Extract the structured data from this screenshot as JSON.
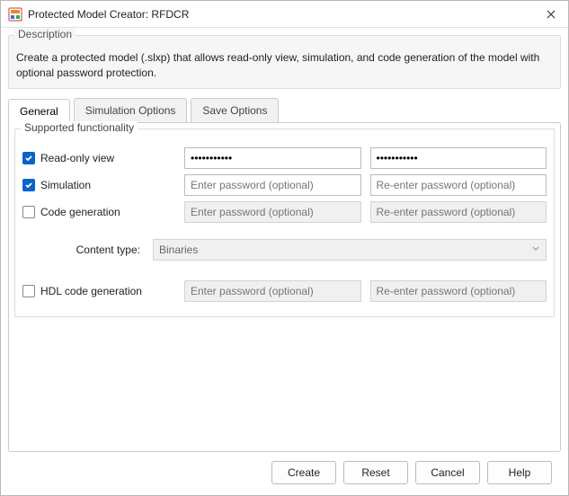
{
  "window": {
    "title": "Protected Model Creator: RFDCR"
  },
  "description": {
    "legend": "Description",
    "text": "Create a protected model (.slxp) that allows read-only view, simulation, and code generation of the model with optional password protection."
  },
  "tabs": {
    "general": "General",
    "simulation_options": "Simulation Options",
    "save_options": "Save Options"
  },
  "general_panel": {
    "supported_legend": "Supported functionality",
    "rows": {
      "read_only": {
        "label": "Read-only view",
        "password_value": "•••••••••••",
        "confirm_value": "•••••••••••"
      },
      "simulation": {
        "label": "Simulation"
      },
      "code_gen": {
        "label": "Code generation"
      },
      "hdl": {
        "label": "HDL code generation"
      }
    },
    "placeholders": {
      "password": "Enter password (optional)",
      "confirm": "Re-enter password (optional)"
    },
    "content_type": {
      "label": "Content type:",
      "value": "Binaries"
    }
  },
  "buttons": {
    "create": "Create",
    "reset": "Reset",
    "cancel": "Cancel",
    "help": "Help"
  }
}
